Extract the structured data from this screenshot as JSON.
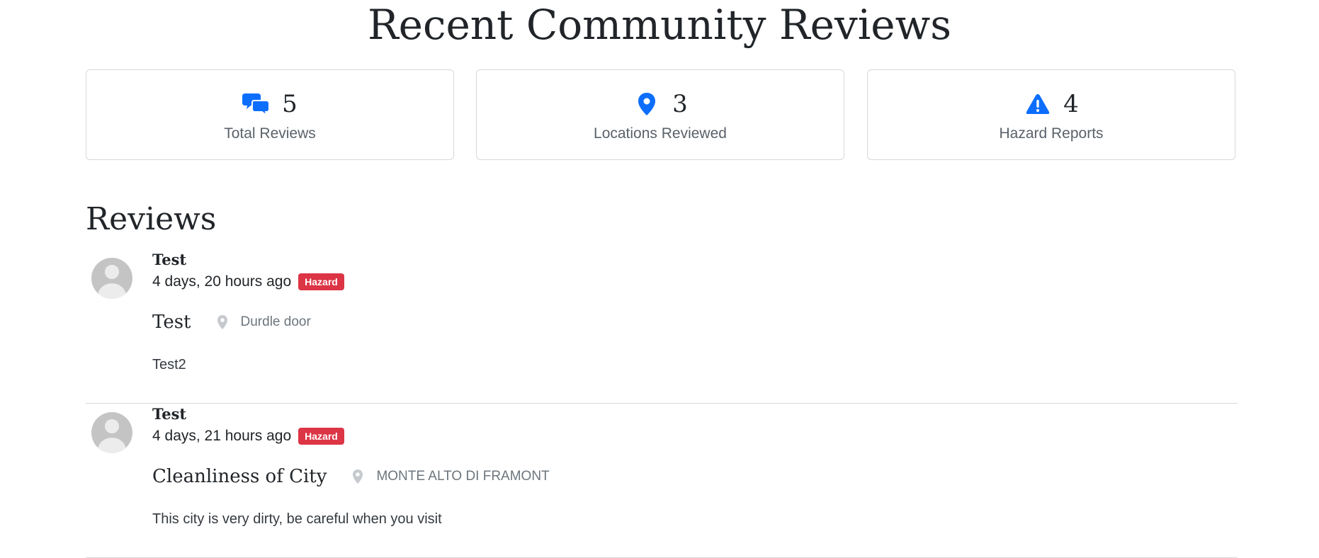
{
  "page": {
    "title": "Recent Community Reviews"
  },
  "stats": [
    {
      "value": "5",
      "label": "Total Reviews",
      "icon": "comments-icon"
    },
    {
      "value": "3",
      "label": "Locations Reviewed",
      "icon": "map-pin-icon"
    },
    {
      "value": "4",
      "label": "Hazard Reports",
      "icon": "warning-triangle-icon"
    }
  ],
  "reviews_section": {
    "title": "Reviews"
  },
  "reviews": [
    {
      "author": "Test",
      "time": "4 days, 20 hours ago",
      "badge": "Hazard",
      "title": "Test",
      "location": "Durdle door",
      "body": "Test2"
    },
    {
      "author": "Test",
      "time": "4 days, 21 hours ago",
      "badge": "Hazard",
      "title": "Cleanliness of City",
      "location": "MONTE ALTO DI FRAMONT",
      "body": "This city is very dirty, be careful when you visit"
    }
  ],
  "colors": {
    "accent": "#0d6efd",
    "hazard": "#dc3545",
    "muted": "#6c757d",
    "border": "#d5d8dc"
  }
}
